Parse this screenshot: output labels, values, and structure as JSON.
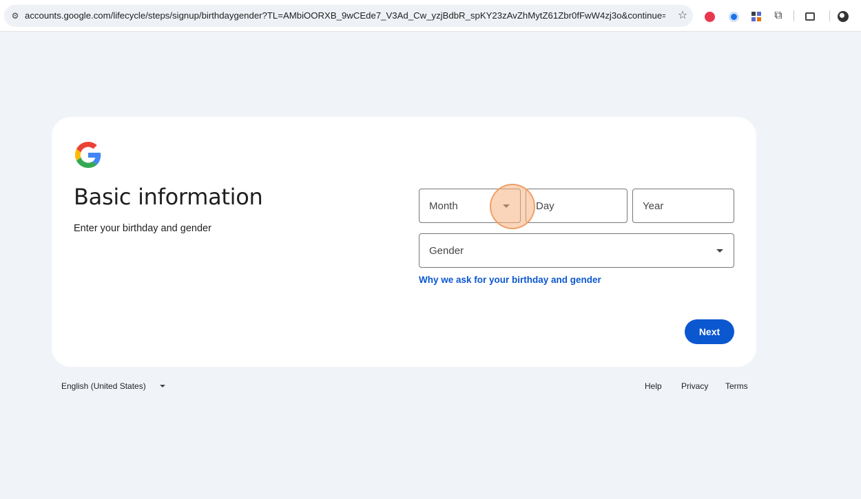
{
  "browser": {
    "url": "accounts.google.com/lifecycle/steps/signup/birthdaygender?TL=AMbiOORXB_9wCEde7_V3Ad_Cw_yzjBdbR_spKY23zAvZhMytZ61Zbr0fFwW4zj3o&continue=https%3...",
    "icons": [
      "site-info-icon",
      "bookmark-star-icon",
      "extension-icon",
      "password-manager-icon",
      "grid-extension-icon",
      "puzzle-extensions-icon",
      "tab-search-icon",
      "profile-icon"
    ]
  },
  "card": {
    "title": "Basic information",
    "subtitle": "Enter your birthday and gender",
    "month_placeholder": "Month",
    "day_placeholder": "Day",
    "year_placeholder": "Year",
    "gender_placeholder": "Gender",
    "why_link": "Why we ask for your birthday and gender",
    "next_label": "Next"
  },
  "footer": {
    "language": "English (United States)",
    "links": [
      "Help",
      "Privacy",
      "Terms"
    ]
  },
  "colors": {
    "page_bg": "#f0f4f9",
    "card_bg": "#ffffff",
    "primary": "#0b57d0",
    "cursor_highlight": "#f8b280"
  }
}
